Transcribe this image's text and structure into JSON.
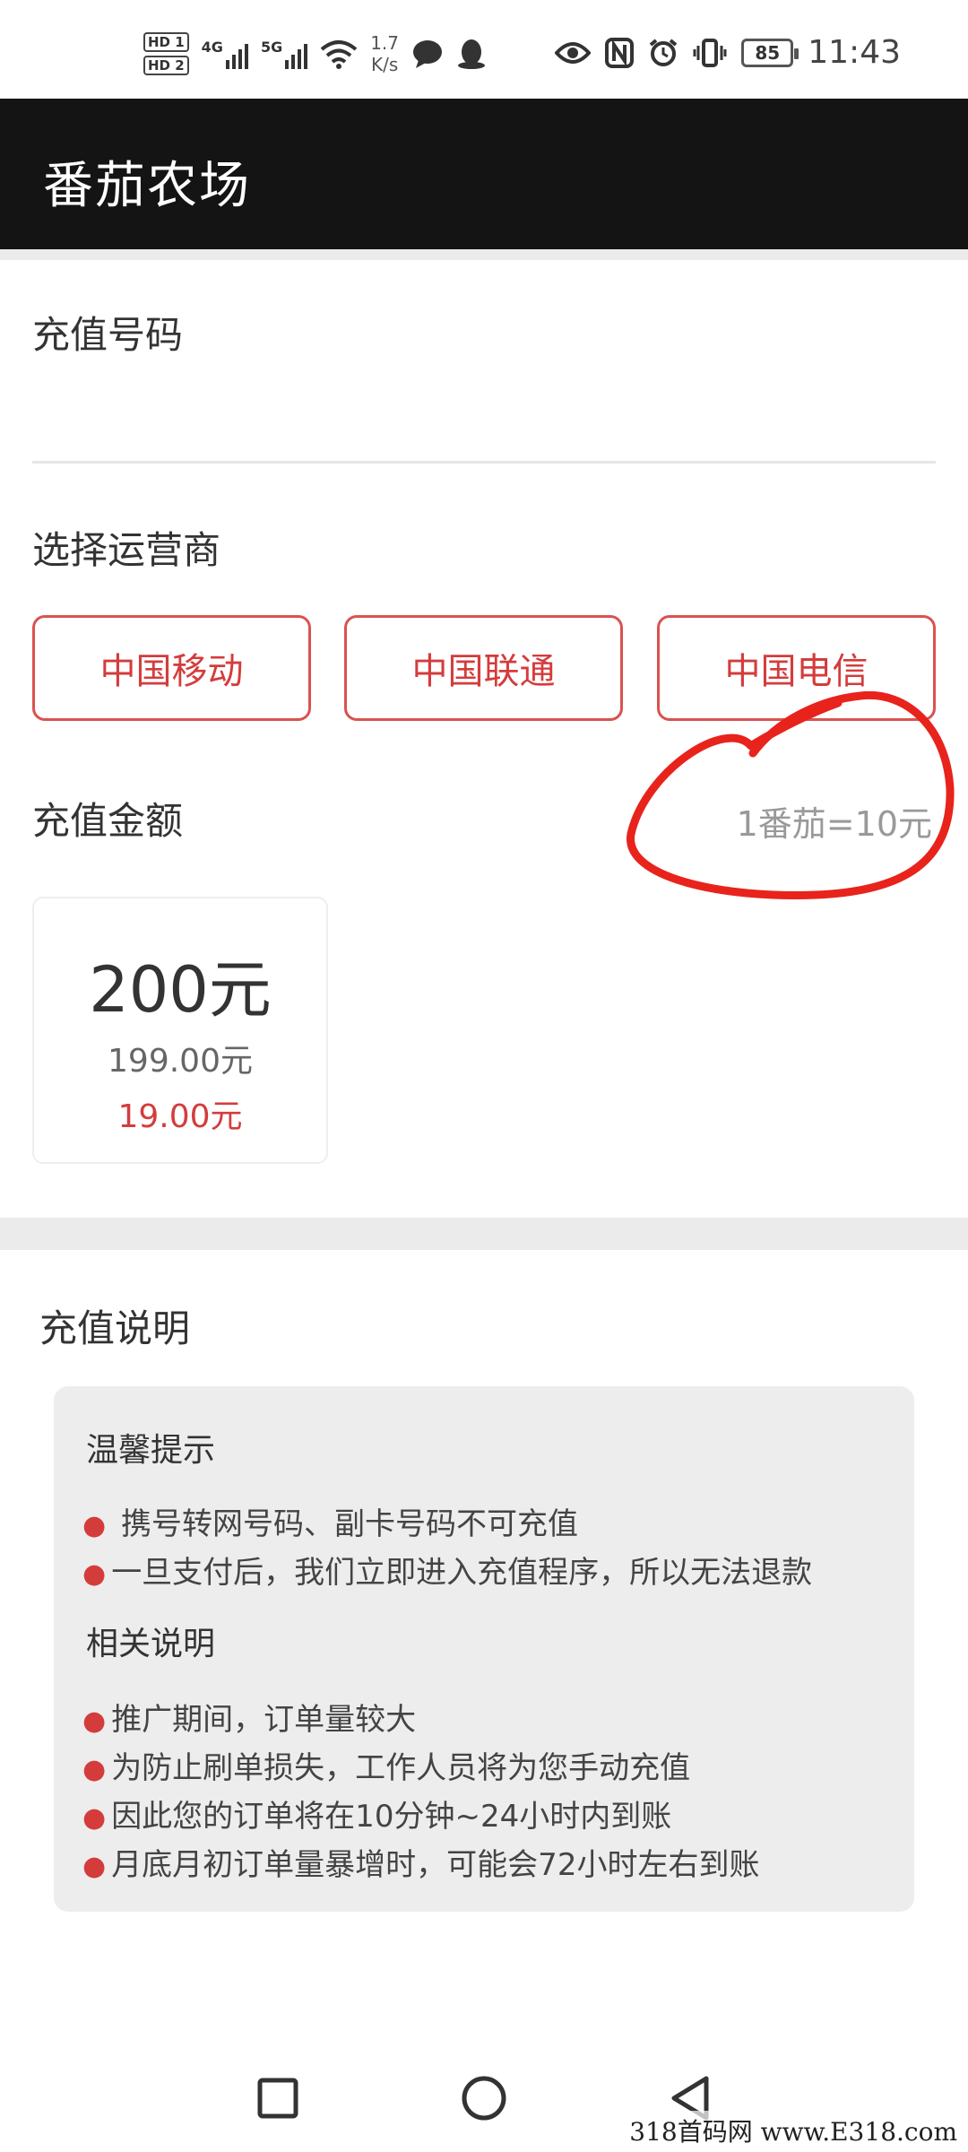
{
  "status_bar": {
    "hd1": "HD 1",
    "hd2": "HD 2",
    "net1": "4G",
    "net2": "5G",
    "speed_value": "1.7",
    "speed_unit": "K/s",
    "battery": "85",
    "time": "11:43",
    "icons": [
      "wifi-icon",
      "message-icon",
      "qq-icon",
      "eye-icon",
      "nfc-icon",
      "alarm-icon",
      "vibrate-icon"
    ]
  },
  "header": {
    "title": "番茄农场"
  },
  "form": {
    "phone_label": "充值号码",
    "carrier_label": "选择运营商",
    "carriers": [
      "中国移动",
      "中国联通",
      "中国电信"
    ],
    "amount_label": "充值金额",
    "rate": "1番茄=10元",
    "amount_card": {
      "face_value": "200元",
      "original_price": "199.00元",
      "price": "19.00元"
    }
  },
  "notice": {
    "title": "充值说明",
    "tips_heading": "温馨提示",
    "tips": [
      "携号转网号码、副卡号码不可充值",
      "一旦支付后，我们立即进入充值程序，所以无法退款"
    ],
    "related_heading": "相关说明",
    "related": [
      "推广期间，订单量较大",
      "为防止刷单损失，工作人员将为您手动充值",
      "因此您的订单将在10分钟~24小时内到账",
      "月底月初订单量暴增时，可能会72小时左右到账"
    ]
  },
  "watermark": "318首码网 www.E318.com",
  "colors": {
    "accent": "#d43c3c",
    "titlebar": "#141414",
    "annotation": "#e8231c"
  }
}
